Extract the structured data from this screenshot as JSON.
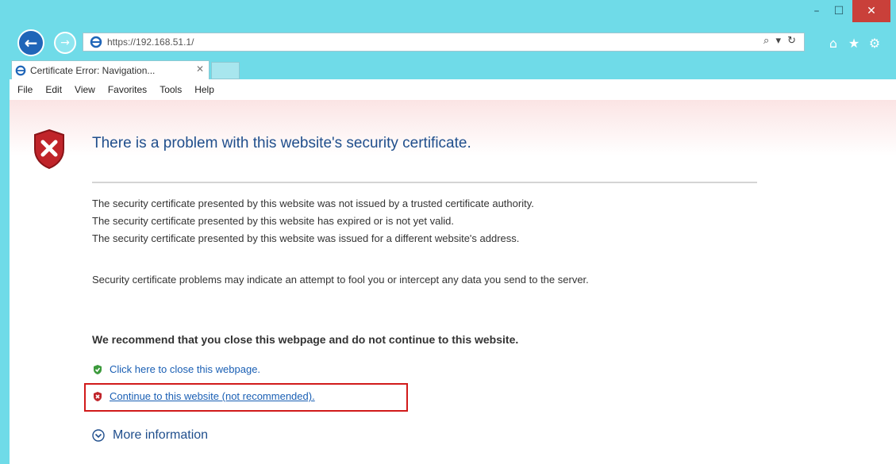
{
  "window": {
    "minimize_glyph": "–",
    "maximize_glyph": "☐",
    "close_glyph": "✕"
  },
  "address_bar": {
    "url": "https://192.168.51.1/",
    "search_refresh": "⌕ ▾ ↻"
  },
  "toolbar_icons": {
    "home": "⌂",
    "favorites": "★",
    "settings": "⚙"
  },
  "tab": {
    "label": "Certificate Error: Navigation...",
    "close_glyph": "✕"
  },
  "menu": {
    "items": [
      "File",
      "Edit",
      "View",
      "Favorites",
      "Tools",
      "Help"
    ]
  },
  "page": {
    "heading": "There is a problem with this website's security certificate.",
    "reasons": [
      "The security certificate presented by this website was not issued by a trusted certificate authority.",
      "The security certificate presented by this website has expired or is not yet valid.",
      "The security certificate presented by this website was issued for a different website's address."
    ],
    "warning": "Security certificate problems may indicate an attempt to fool you or intercept any data you send to the server.",
    "recommendation": "We recommend that you close this webpage and do not continue to this website.",
    "close_link": "Click here to close this webpage.",
    "continue_link": "Continue to this website (not recommended).",
    "more_info": "More information"
  },
  "colors": {
    "frame": "#6fdbe8",
    "heading": "#1f4e8c",
    "link": "#1a5fb4",
    "highlight": "#d11a1a",
    "shield_red": "#c0242a",
    "shield_green": "#3c9a3c"
  }
}
